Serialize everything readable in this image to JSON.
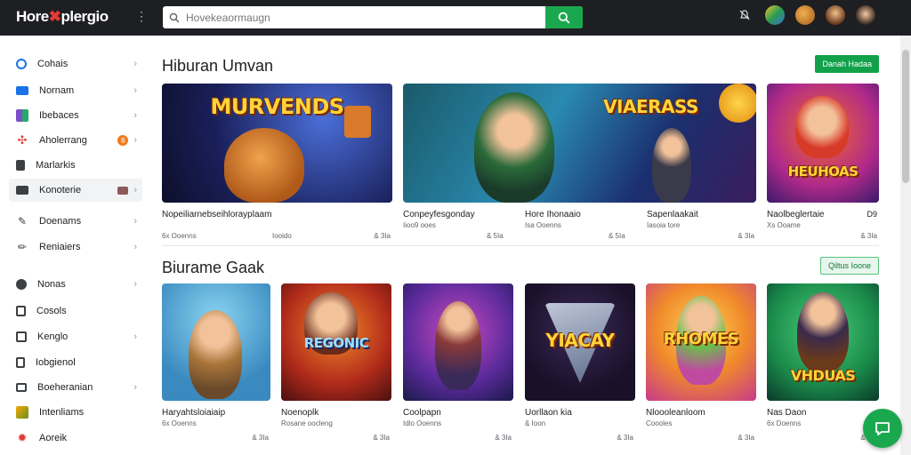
{
  "header": {
    "logo_main": "Hore",
    "logo_accent": "plergio",
    "search_placeholder": "Hovekeaormaugn"
  },
  "sidebar": {
    "items": [
      {
        "label": "Cohais",
        "icon": "grid-icon",
        "color": "#1a73e8"
      },
      {
        "label": "Nornam",
        "icon": "tv-icon",
        "color": "#1a73e8"
      },
      {
        "label": "Ibebaces",
        "icon": "library-icon",
        "color": "#7b4fc9"
      },
      {
        "label": "Aholerrang",
        "icon": "pinwheel-icon",
        "color": "#e53935",
        "badge": "8"
      },
      {
        "label": "Marlarkis",
        "icon": "bookmark-icon",
        "color": "#3c4043"
      },
      {
        "label": "Konoterie",
        "icon": "controller-icon",
        "color": "#3c4043"
      },
      {
        "label": "Doenams",
        "icon": "paint-icon",
        "color": "#3c4043"
      },
      {
        "label": "Reniaiers",
        "icon": "pencil-icon",
        "color": "#3c4043"
      },
      {
        "label": "Nonas",
        "icon": "globe-icon",
        "color": "#3c4043"
      },
      {
        "label": "Cosols",
        "icon": "calendar-icon",
        "color": "#3c4043"
      },
      {
        "label": "Kenglo",
        "icon": "dice-icon",
        "color": "#3c4043"
      },
      {
        "label": "Iobgienol",
        "icon": "book-icon",
        "color": "#3c4043"
      },
      {
        "label": "Boeheranian",
        "icon": "briefcase-icon",
        "color": "#3c4043"
      },
      {
        "label": "Intenliams",
        "icon": "puzzle-icon",
        "color": "#f2a900"
      },
      {
        "label": "Aoreik",
        "icon": "flame-icon",
        "color": "#e53935"
      }
    ]
  },
  "sections": [
    {
      "title": "Hiburan Umvan",
      "button": "Danah Hadaa",
      "cards": [
        {
          "art": "MURVENDS",
          "title": "Nopeiliarnebseihlorayplaam",
          "sub": "6x Ooenns",
          "meta": "Iooido",
          "meta2": "& 3Ia"
        },
        {
          "art": "VIAERASS",
          "title": "Conpeyfesgonday",
          "sub": "Iioo9 ooes",
          "meta": "& 5Ia",
          "title2": "Hore Ihonaaio",
          "sub2": "Isa Ooenns",
          "meta2": "& 5Ia"
        },
        {
          "art": "",
          "title": "Sapenlaakait",
          "sub": "Iasoia tore",
          "meta": "& 3Ia"
        },
        {
          "art": "HEUHOAS",
          "title": "Naolbeglertaie",
          "sub": "Xs Ooame",
          "meta": "& 3Ia",
          "extra": "D9"
        }
      ]
    },
    {
      "title": "Biurame Gaak",
      "button": "Qiltus Ioone",
      "cards": [
        {
          "art": "",
          "title": "Haryahtsloiaiaip",
          "sub": "6x Ooenns",
          "meta": "& 3Ia"
        },
        {
          "art": "REGONIC",
          "title": "Noenoplk",
          "sub": "Rosane oocleng",
          "meta": "& 3Ia"
        },
        {
          "art": "",
          "title": "Coolpapn",
          "sub": "Idlo Ooenns",
          "meta": "& 3Ia"
        },
        {
          "art": "YIACAY",
          "title": "Uorllaon kia",
          "sub": "& Ioon",
          "meta": "& 3Ia"
        },
        {
          "art": "RHOMES",
          "title": "Nloooleanloom",
          "sub": "Coooles",
          "meta": "& 3Ia"
        },
        {
          "art": "VHDUAS",
          "title": "Nas Daon",
          "sub": "6x Doenns",
          "meta": "& 3Ia"
        }
      ]
    }
  ]
}
